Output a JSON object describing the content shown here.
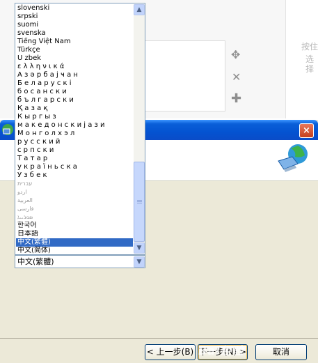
{
  "background": {
    "hint_lines": [
      "按住",
      "选择"
    ],
    "icons": [
      "move-icon",
      "close-icon",
      "plus-icon"
    ]
  },
  "language_list": {
    "items": [
      {
        "label": "slovenski"
      },
      {
        "label": "srpski"
      },
      {
        "label": "suomi"
      },
      {
        "label": "svenska"
      },
      {
        "label": "Tiếng Việt Nam"
      },
      {
        "label": "Türkçe"
      },
      {
        "label": "Ŭ zbek"
      },
      {
        "label": "ε λ λ η ν ι κ ά"
      },
      {
        "label": "А з ә р б а ј ҹ а н"
      },
      {
        "label": "Б е л а р у с к і"
      },
      {
        "label": "б о с а н с к и"
      },
      {
        "label": "б ъ л г а р с к и"
      },
      {
        "label": "Қ а з а қ"
      },
      {
        "label": "К ы р г ы з"
      },
      {
        "label": "м а к е д о н с к и  ј а з и"
      },
      {
        "label": "М о н г о л  х э л"
      },
      {
        "label": "р у с с к и й"
      },
      {
        "label": "с р п с к и"
      },
      {
        "label": "Т а т а р"
      },
      {
        "label": "у к р а ї н ь с к а"
      },
      {
        "label": "Ў з б е к"
      },
      {
        "label": "עברית",
        "faint": true
      },
      {
        "label": "اردو",
        "faint": true
      },
      {
        "label": "العربية",
        "faint": true
      },
      {
        "label": "فارسی",
        "faint": true
      },
      {
        "label": "ܣܘܪܝܝܐ",
        "faint": true
      },
      {
        "label": "한국어"
      },
      {
        "label": "日本語"
      },
      {
        "label": "中文(繁體)",
        "selected": true
      },
      {
        "label": "中文(简体)"
      }
    ]
  },
  "combo": {
    "value": "中文(繁體)"
  },
  "dialog": {
    "close_label": "×",
    "buttons": {
      "back": "< 上一步(B)",
      "next": "下一步(N) >",
      "cancel": "取消"
    }
  },
  "watermark": "Bai经验"
}
